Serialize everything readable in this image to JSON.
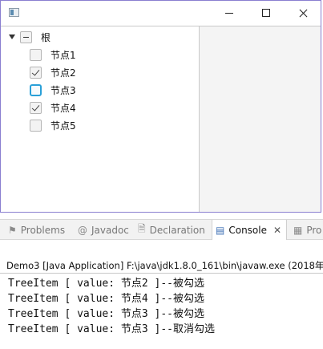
{
  "tree": {
    "root": {
      "label": "根",
      "state": "indeterminate",
      "expanded": true
    },
    "children": [
      {
        "label": "节点1",
        "state": "unchecked"
      },
      {
        "label": "节点2",
        "state": "checked"
      },
      {
        "label": "节点3",
        "state": "focused"
      },
      {
        "label": "节点4",
        "state": "checked"
      },
      {
        "label": "节点5",
        "state": "unchecked"
      }
    ]
  },
  "tabs": [
    {
      "label": "Problems",
      "icon": "problems-icon",
      "active": false
    },
    {
      "label": "Javadoc",
      "icon": "at-icon",
      "active": false
    },
    {
      "label": "Declaration",
      "icon": "declaration-icon",
      "active": false
    },
    {
      "label": "Console",
      "icon": "console-icon",
      "active": true
    },
    {
      "label": "Pro",
      "icon": "progress-icon",
      "active": false
    }
  ],
  "console": {
    "header": "Demo3 [Java Application] F:\\java\\jdk1.8.0_161\\bin\\javaw.exe (2018年",
    "lines": [
      "TreeItem [ value: 节点2 ]--被勾选",
      "TreeItem [ value: 节点4 ]--被勾选",
      "TreeItem [ value: 节点3 ]--被勾选",
      "TreeItem [ value: 节点3 ]--取消勾选"
    ]
  },
  "colors": {
    "window_border": "#8a7fd0",
    "focus_ring": "#2aa0d8",
    "panel_background": "#f4f4f4"
  }
}
